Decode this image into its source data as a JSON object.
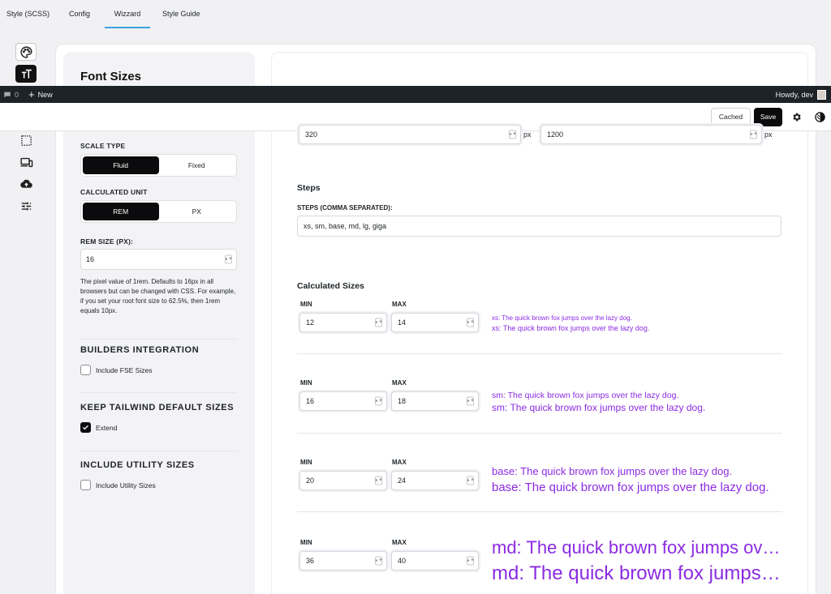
{
  "panel_title": "Font Sizes",
  "admin_bar": {
    "comments_count": "0",
    "new_label": "New",
    "howdy": "Howdy, dev"
  },
  "tabs": [
    "Style (SCSS)",
    "Config",
    "Wizzard",
    "Style Guide"
  ],
  "active_tab": "Wizzard",
  "toolbar": {
    "cached_label": "Cached",
    "save_label": "Save"
  },
  "left": {
    "scale_type_label": "SCALE TYPE",
    "scale_type_options": [
      "Fluid",
      "Fixed"
    ],
    "scale_type_selected": "Fluid",
    "calc_unit_label": "CALCULATED UNIT",
    "calc_unit_options": [
      "REM",
      "PX"
    ],
    "calc_unit_selected": "REM",
    "rem_size_label": "REM SIZE (PX):",
    "rem_size_value": "16",
    "rem_help": "The pixel value of 1rem. Defaults to 16px in all browsers but can be changed with CSS. For example, if you set your root font size to 62.5%, then 1rem equals 10px.",
    "builders_head": "BUILDERS INTEGRATION",
    "fse_label": "Include FSE Sizes",
    "fse_checked": false,
    "keep_head": "KEEP TAILWIND DEFAULT SIZES",
    "extend_label": "Extend",
    "extend_checked": true,
    "utility_head": "INCLUDE UTILITY SIZES",
    "utility_label": "Include Utility Sizes",
    "utility_checked": false
  },
  "right": {
    "viewport_min": "320",
    "viewport_max": "1200",
    "px_unit": "px",
    "steps_head": "Steps",
    "steps_label": "STEPS (COMMA SEPARATED):",
    "steps_value": "xs, sm, base, md, lg, giga",
    "calc_head": "Calculated Sizes",
    "min_label": "MIN",
    "max_label": "MAX",
    "sizes": [
      {
        "min": "12",
        "max": "14",
        "preview_min": "xs: The quick brown fox jumps over the lazy dog.",
        "preview_max": "xs: The quick brown fox jumps over the lazy dog."
      },
      {
        "min": "16",
        "max": "18",
        "preview_min": "sm: The quick brown fox jumps over the lazy dog.",
        "preview_max": "sm: The quick brown fox jumps over the lazy dog."
      },
      {
        "min": "20",
        "max": "24",
        "preview_min": "base: The quick brown fox jumps over the lazy dog.",
        "preview_max": "base: The quick brown fox jumps over the lazy dog."
      },
      {
        "min": "36",
        "max": "40",
        "preview_min": "md: The quick brown fox jumps over the lazy dog.",
        "preview_max": "md: The quick brown fox jumps over the lazy dog."
      }
    ]
  },
  "colors": {
    "accent": "#8b2be2",
    "active_tab_underline": "#3aa0e0",
    "primary_button": "#0b0b0d"
  },
  "rail_icons": [
    "palette-icon",
    "typography-icon",
    "crop-icon",
    "devices-icon",
    "cloud-upload-icon",
    "sliders-icon"
  ],
  "toolbar_icons": [
    "gear-icon",
    "contrast-icon"
  ]
}
